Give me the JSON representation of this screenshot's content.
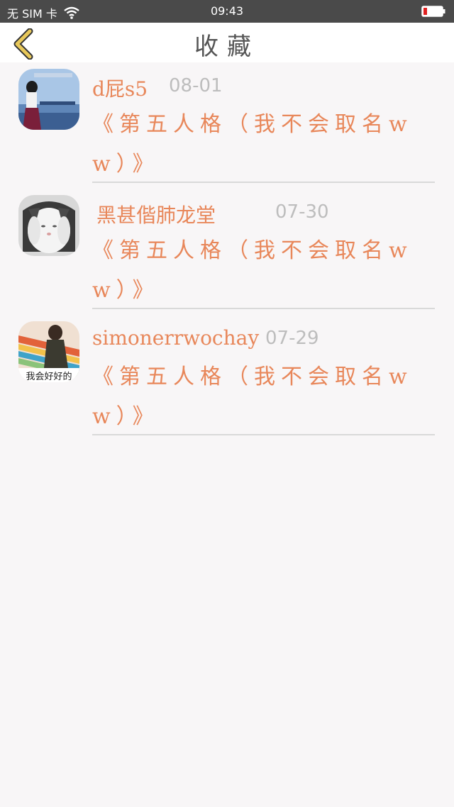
{
  "status_bar": {
    "carrier": "无 SIM 卡",
    "time": "09:43",
    "battery_color": "#e02020"
  },
  "header": {
    "title": "收藏",
    "back_icon": "chevron-left-icon",
    "back_color": "#e8c85a"
  },
  "favorites": [
    {
      "user": "d屁s5",
      "date": "08-01",
      "title": "《第五人格（我不会取名ww）》"
    },
    {
      "user": "黑甚偕肺龙堂",
      "date": "07-30",
      "title": "《第五人格（我不会取名ww）》"
    },
    {
      "user": "simonerrwochay",
      "date": "07-29",
      "title": "《第五人格（我不会取名ww）》",
      "avatar_caption": "我会好好的"
    }
  ],
  "colors": {
    "accent": "#e8875a",
    "date": "#bdbdbd",
    "background": "#f8f6f7"
  }
}
